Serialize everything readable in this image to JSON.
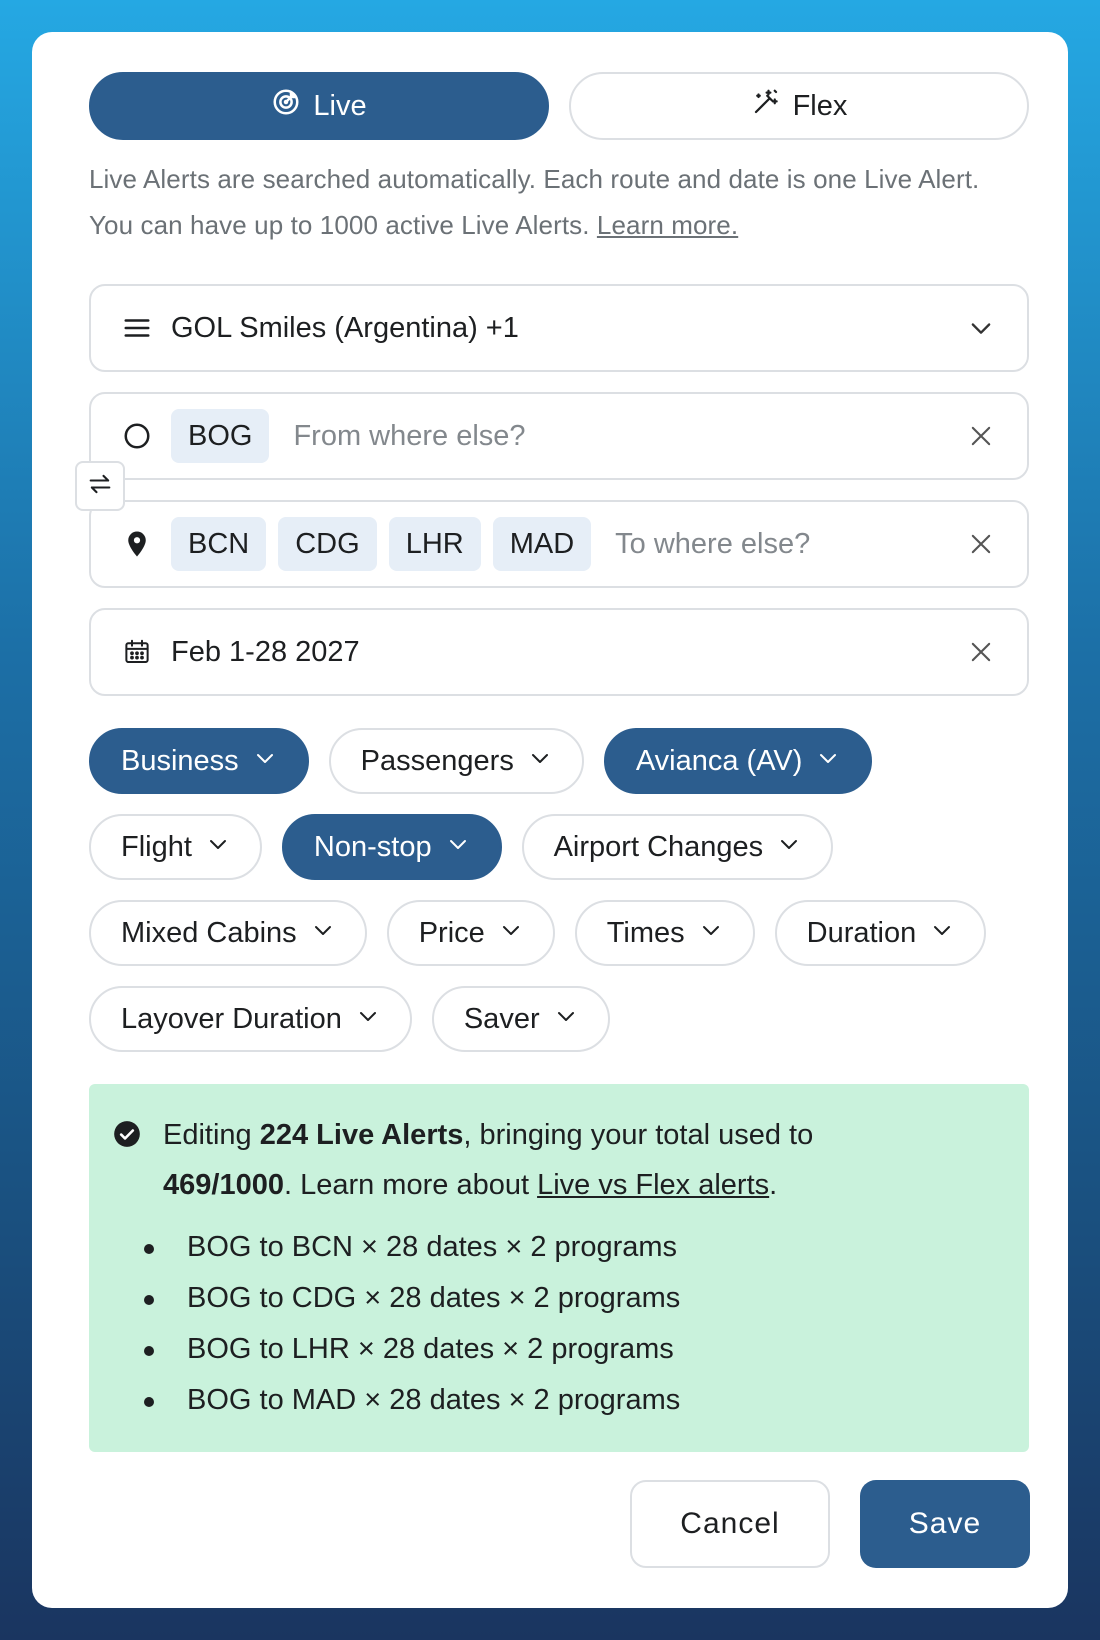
{
  "mode": {
    "live_label": "Live",
    "flex_label": "Flex",
    "description": "Live Alerts are searched automatically. Each route and date is one Live Alert. You can have up to 1000 active Live Alerts.",
    "learn_more": "Learn more."
  },
  "program_select": {
    "value": "GOL Smiles (Argentina) +1"
  },
  "origin": {
    "tags": [
      "BOG"
    ],
    "placeholder": "From where else?"
  },
  "destination": {
    "tags": [
      "BCN",
      "CDG",
      "LHR",
      "MAD"
    ],
    "placeholder": "To where else?"
  },
  "dates": {
    "value": "Feb 1-28 2027"
  },
  "filters": [
    {
      "label": "Business",
      "active": true
    },
    {
      "label": "Passengers",
      "active": false
    },
    {
      "label": "Avianca (AV)",
      "active": true
    },
    {
      "label": "Flight",
      "active": false
    },
    {
      "label": "Non-stop",
      "active": true
    },
    {
      "label": "Airport Changes",
      "active": false
    },
    {
      "label": "Mixed Cabins",
      "active": false
    },
    {
      "label": "Price",
      "active": false
    },
    {
      "label": "Times",
      "active": false
    },
    {
      "label": "Duration",
      "active": false
    },
    {
      "label": "Layover Duration",
      "active": false
    },
    {
      "label": "Saver",
      "active": false
    }
  ],
  "summary": {
    "prefix": "Editing ",
    "count_bold": "224 Live Alerts",
    "middle": ", bringing your total used to ",
    "total_bold": "469/1000",
    "after_total": ". Learn more about ",
    "link": "Live vs Flex alerts",
    "suffix": ".",
    "items": [
      "BOG to BCN × 28 dates × 2 programs",
      "BOG to CDG × 28 dates × 2 programs",
      "BOG to LHR × 28 dates × 2 programs",
      "BOG to MAD × 28 dates × 2 programs"
    ]
  },
  "footer": {
    "cancel_label": "Cancel",
    "save_label": "Save"
  },
  "colors": {
    "accent": "#2c5d8e",
    "summary_bg": "#c9f2dc",
    "tag_bg": "#e6eef7",
    "border": "#dcdfe3"
  }
}
